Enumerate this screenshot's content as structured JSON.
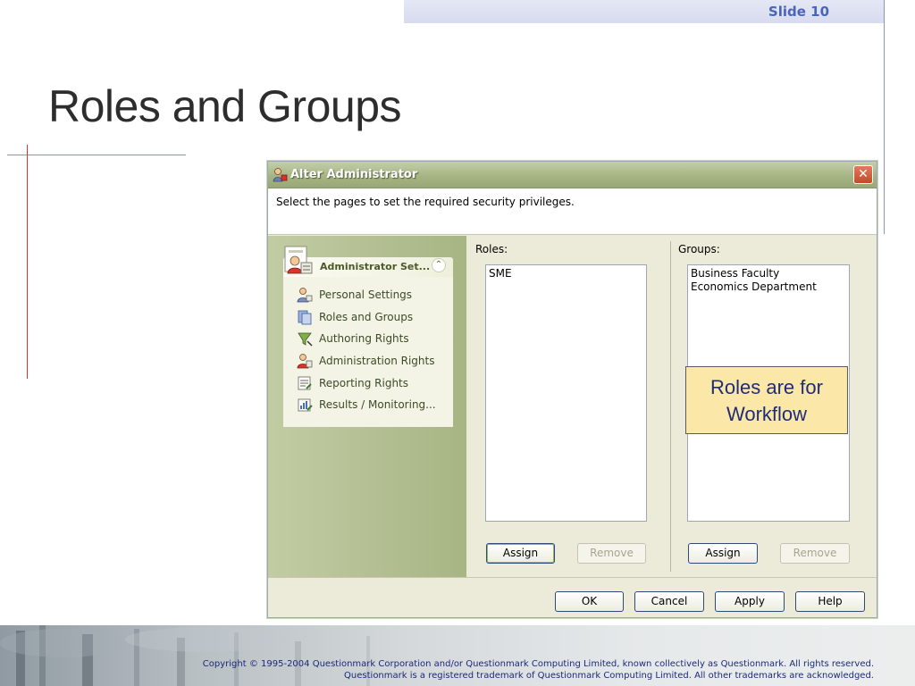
{
  "slide": {
    "number_label": "Slide 10",
    "title": "Roles and Groups"
  },
  "dialog": {
    "title": "Alter Administrator",
    "close_glyph": "✕",
    "instruction": "Select the pages to set the required security privileges.",
    "task_panel": {
      "header": "Administrator Set...",
      "collapse_glyph": "⌃",
      "items": [
        {
          "label": "Personal Settings",
          "icon": "personal-settings-icon"
        },
        {
          "label": "Roles and Groups",
          "icon": "roles-groups-icon"
        },
        {
          "label": "Authoring Rights",
          "icon": "authoring-rights-icon"
        },
        {
          "label": "Administration Rights",
          "icon": "administration-rights-icon"
        },
        {
          "label": "Reporting Rights",
          "icon": "reporting-rights-icon"
        },
        {
          "label": "Results / Monitoring...",
          "icon": "results-monitoring-icon"
        }
      ]
    },
    "roles": {
      "label": "Roles:",
      "items": [
        "SME"
      ],
      "assign": "Assign",
      "remove": "Remove"
    },
    "groups": {
      "label": "Groups:",
      "items": [
        "Business Faculty",
        "Economics Department"
      ],
      "assign": "Assign",
      "remove": "Remove"
    },
    "callout": {
      "line1": "Roles are for",
      "line2": "Workflow"
    },
    "footer": {
      "ok": "OK",
      "cancel": "Cancel",
      "apply": "Apply",
      "help": "Help"
    }
  },
  "copyright": {
    "line1": "Copyright © 1995-2004 Questionmark Corporation and/or Questionmark Computing Limited, known collectively as Questionmark. All rights reserved.",
    "line2": "Questionmark is a registered trademark of Questionmark Computing Limited. All other trademarks are acknowledged."
  },
  "colors": {
    "title_bar": "#a7b584",
    "task_pane": "#c2cca4",
    "callout": "#fbe8a9",
    "slide_accent": "#4a64b8"
  }
}
